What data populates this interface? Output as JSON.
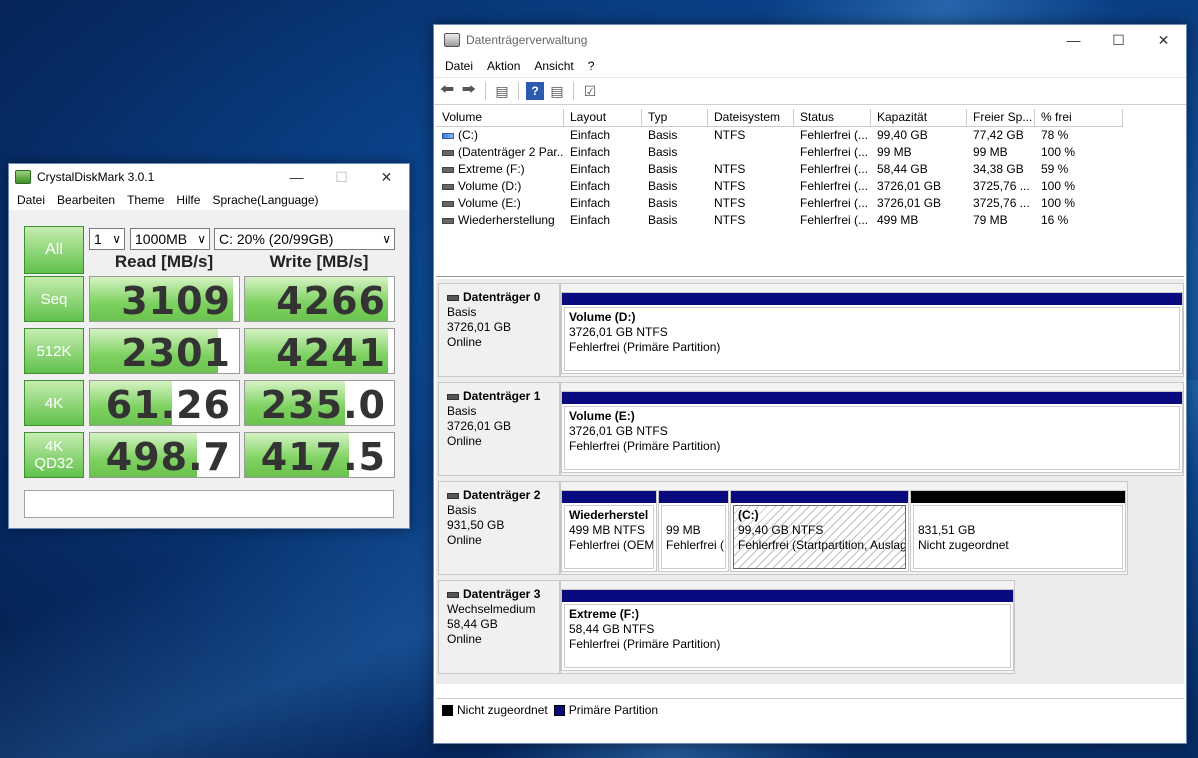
{
  "cdm": {
    "title": "CrystalDiskMark 3.0.1",
    "menu": [
      "Datei",
      "Bearbeiten",
      "Theme",
      "Hilfe",
      "Sprache(Language)"
    ],
    "all_label": "All",
    "count": "1",
    "size": "1000MB",
    "drive": "C: 20% (20/99GB)",
    "read_header": "Read [MB/s]",
    "write_header": "Write [MB/s]",
    "rows": [
      {
        "label": "Seq",
        "read": "3109",
        "write": "4266",
        "read_fill": 0.96,
        "write_fill": 0.96
      },
      {
        "label": "512K",
        "read": "2301",
        "write": "4241",
        "read_fill": 0.86,
        "write_fill": 0.96
      },
      {
        "label": "4K",
        "read": "61.26",
        "write": "235.0",
        "read_fill": 0.55,
        "write_fill": 0.67
      },
      {
        "label": "4K\nQD32",
        "read": "498.7",
        "write": "417.5",
        "read_fill": 0.72,
        "write_fill": 0.7
      }
    ],
    "status": ""
  },
  "dm": {
    "title": "Datenträgerverwaltung",
    "menu": [
      "Datei",
      "Aktion",
      "Ansicht",
      "?"
    ],
    "columns": [
      "Volume",
      "Layout",
      "Typ",
      "Dateisystem",
      "Status",
      "Kapazität",
      "Freier Sp...",
      "% frei"
    ],
    "volumes": [
      {
        "name": "(C:)",
        "layout": "Einfach",
        "type": "Basis",
        "fs": "NTFS",
        "status": "Fehlerfrei (...",
        "cap": "99,40 GB",
        "free": "77,42 GB",
        "pct": "78 %",
        "icon": "system-volume-icon"
      },
      {
        "name": "(Datenträger 2 Par...",
        "layout": "Einfach",
        "type": "Basis",
        "fs": "",
        "status": "Fehlerfrei (...",
        "cap": "99 MB",
        "free": "99 MB",
        "pct": "100 %",
        "icon": "volume-icon"
      },
      {
        "name": "Extreme (F:)",
        "layout": "Einfach",
        "type": "Basis",
        "fs": "NTFS",
        "status": "Fehlerfrei (...",
        "cap": "58,44 GB",
        "free": "34,38 GB",
        "pct": "59 %",
        "icon": "volume-icon"
      },
      {
        "name": "Volume (D:)",
        "layout": "Einfach",
        "type": "Basis",
        "fs": "NTFS",
        "status": "Fehlerfrei (...",
        "cap": "3726,01 GB",
        "free": "3725,76 ...",
        "pct": "100 %",
        "icon": "volume-icon"
      },
      {
        "name": "Volume (E:)",
        "layout": "Einfach",
        "type": "Basis",
        "fs": "NTFS",
        "status": "Fehlerfrei (...",
        "cap": "3726,01 GB",
        "free": "3725,76 ...",
        "pct": "100 %",
        "icon": "volume-icon"
      },
      {
        "name": "Wiederherstellung",
        "layout": "Einfach",
        "type": "Basis",
        "fs": "NTFS",
        "status": "Fehlerfrei (...",
        "cap": "499 MB",
        "free": "79 MB",
        "pct": "16 %",
        "icon": "volume-icon"
      }
    ],
    "disks": [
      {
        "name": "Datenträger 0",
        "type": "Basis",
        "size": "3726,01 GB",
        "state": "Online",
        "parts": [
          {
            "title": "Volume  (D:)",
            "size": "3726,01 GB NTFS",
            "status": "Fehlerfrei (Primäre Partition)"
          }
        ]
      },
      {
        "name": "Datenträger 1",
        "type": "Basis",
        "size": "3726,01 GB",
        "state": "Online",
        "parts": [
          {
            "title": "Volume  (E:)",
            "size": "3726,01 GB NTFS",
            "status": "Fehlerfrei (Primäre Partition)"
          }
        ]
      },
      {
        "name": "Datenträger 2",
        "type": "Basis",
        "size": "931,50 GB",
        "state": "Online",
        "parts": [
          {
            "title": "Wiederherstel",
            "size": "499 MB NTFS",
            "status": "Fehlerfrei (OEM"
          },
          {
            "title": "",
            "size": "99 MB",
            "status": "Fehlerfrei ("
          },
          {
            "title": "(C:)",
            "size": "99,40 GB NTFS",
            "status": "Fehlerfrei (Startpartition, Auslag"
          },
          {
            "title": "",
            "size": "831,51 GB",
            "status": "Nicht zugeordnet"
          }
        ]
      },
      {
        "name": "Datenträger 3",
        "type": "Wechselmedium",
        "size": "58,44 GB",
        "state": "Online",
        "parts": [
          {
            "title": "Extreme  (F:)",
            "size": "58,44 GB NTFS",
            "status": "Fehlerfrei (Primäre Partition)"
          }
        ]
      }
    ],
    "legend": [
      "Nicht zugeordnet",
      "Primäre Partition"
    ]
  }
}
